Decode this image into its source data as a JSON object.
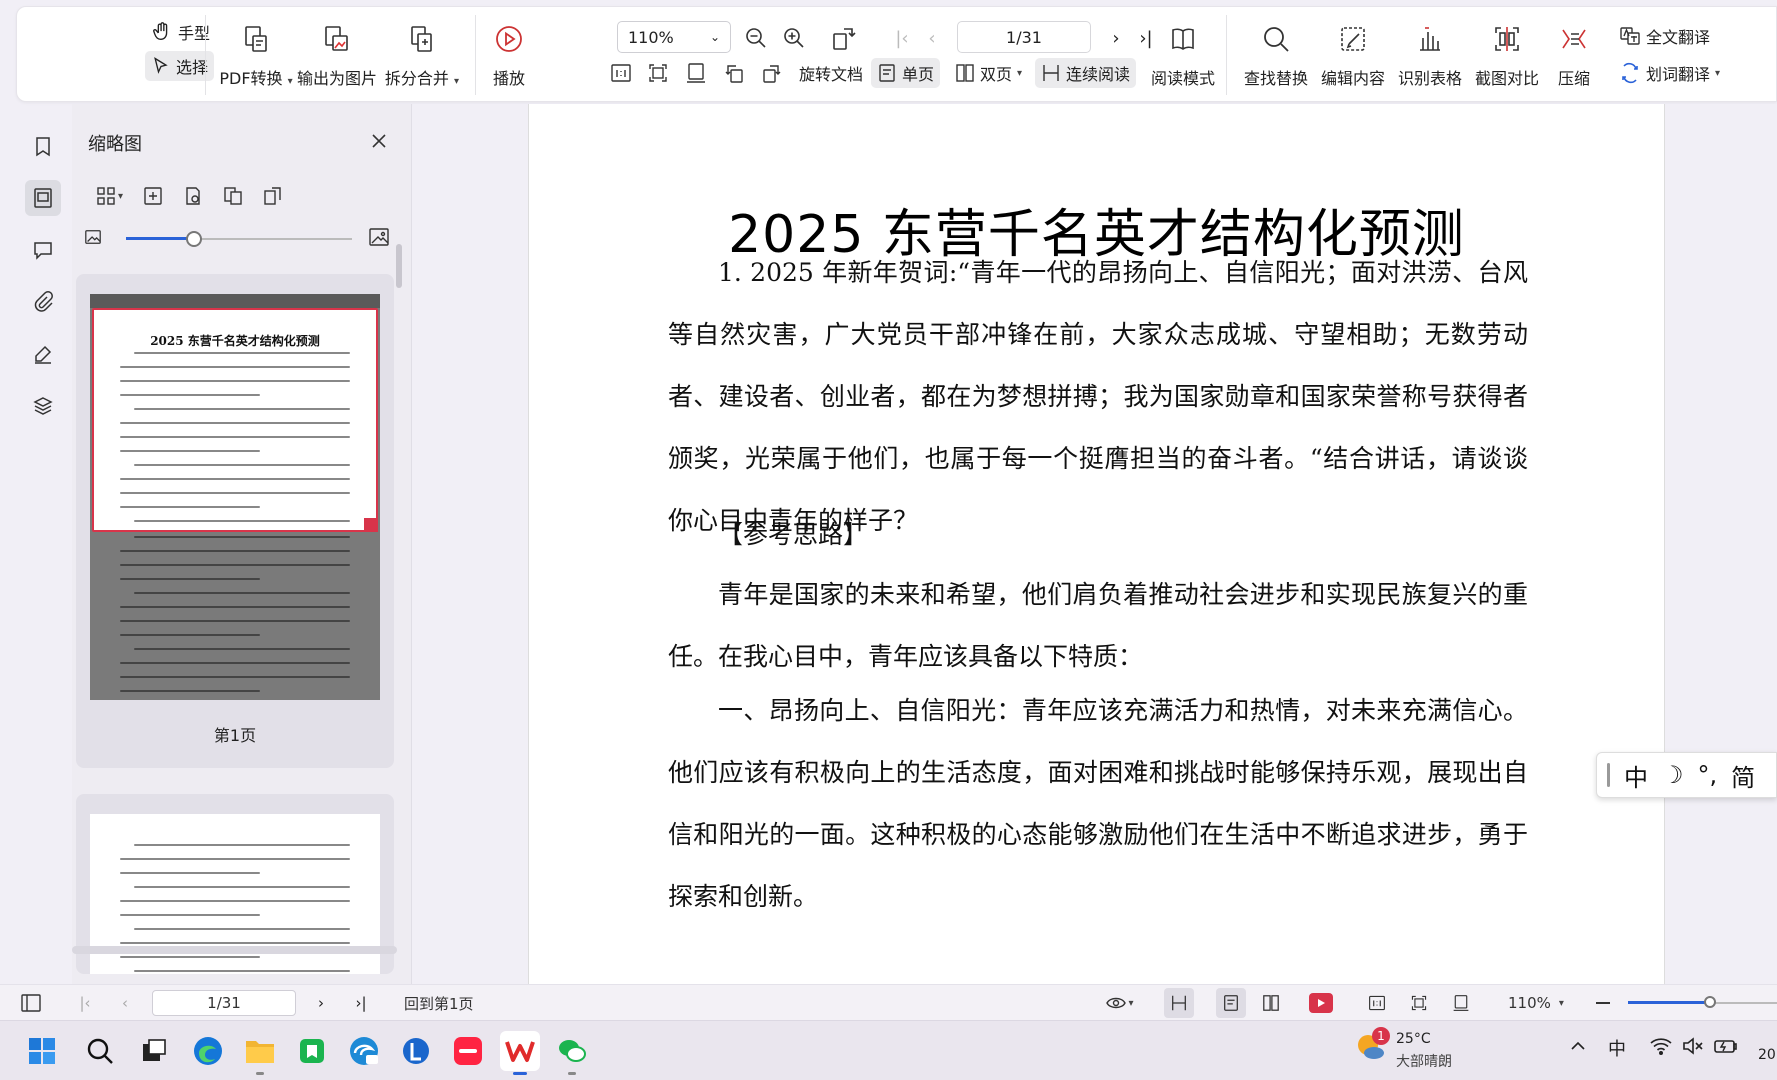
{
  "toolbar": {
    "hand_label": "手型",
    "select_label": "选择",
    "pdf_convert_label": "PDF转换",
    "export_image_label": "输出为图片",
    "split_merge_label": "拆分合并",
    "play_label": "播放",
    "zoom_value": "110%",
    "page_indicator": "1/31",
    "rotate_doc_label": "旋转文档",
    "single_page_label": "单页",
    "double_page_label": "双页",
    "continuous_label": "连续阅读",
    "reading_mode_label": "阅读模式",
    "find_replace_label": "查找替换",
    "edit_content_label": "编辑内容",
    "recognize_table_label": "识别表格",
    "screenshot_compare_label": "截图对比",
    "compress_label": "压缩",
    "full_translate_label": "全文翻译",
    "word_translate_label": "划词翻译"
  },
  "thumbnail_panel": {
    "title": "缩略图",
    "thumb1_title": "2025 东营千名英才结构化预测",
    "page1_label": "第1页",
    "slider_level": 0.3
  },
  "document": {
    "title": "2025 东营千名英才结构化预测",
    "paragraphs": [
      "1. 2025 年新年贺词:“青年一代的昂扬向上、自信阳光；面对洪涝、台风等自然灾害，广大党员干部冲锋在前，大家众志成城、守望相助；无数劳动者、建设者、创业者，都在为梦想拼搏；我为国家勋章和国家荣誉称号获得者颁奖，光荣属于他们，也属于每一个挺膺担当的奋斗者。“结合讲话，请谈谈你心目中青年的样子？",
      "【参考思路】",
      "青年是国家的未来和希望，他们肩负着推动社会进步和实现民族复兴的重任。在我心目中，青年应该具备以下特质：",
      "一、昂扬向上、自信阳光：青年应该充满活力和热情，对未来充满信心。他们应该有积极向上的生活态度，面对困难和挑战时能够保持乐观，展现出自信和阳光的一面。这种积极的心态能够激励他们在生活中不断追求进步，勇于探索和创新。"
    ]
  },
  "ime": {
    "lang": "中",
    "moon": "☽",
    "punct": "°,",
    "mode": "简"
  },
  "statusbar": {
    "page_indicator": "1/31",
    "back_to_first": "回到第1页",
    "zoom": "110%",
    "zoom_level": 0.55
  },
  "taskbar": {
    "weather_temp": "25°C",
    "weather_desc": "大部晴朗",
    "weather_badge": "1",
    "ime_lang": "中",
    "clock_partial": "20"
  }
}
